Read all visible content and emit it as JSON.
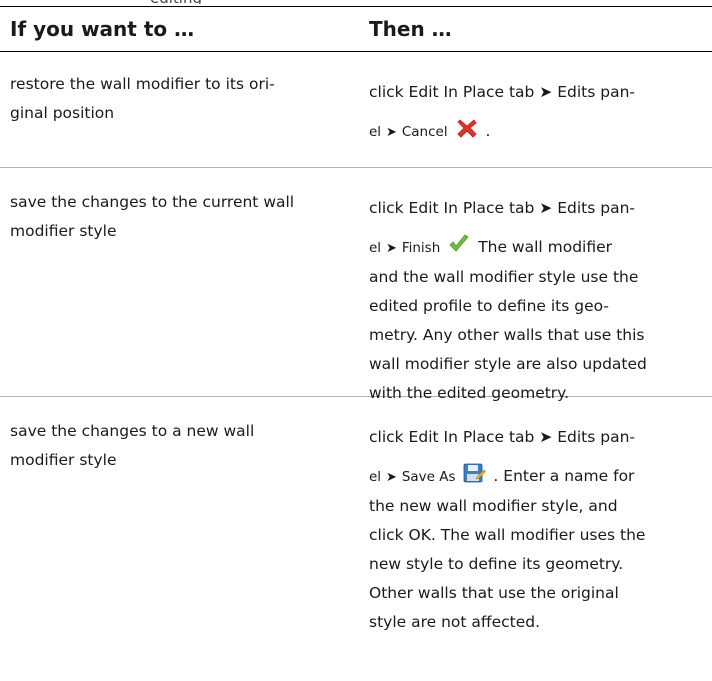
{
  "top_cut_text": "editing",
  "table": {
    "header": {
      "col1": "If you want to …",
      "col2": "Then …"
    },
    "rows": [
      {
        "col1_lines": [
          "restore the wall modifier to its ori-",
          "ginal position"
        ],
        "col2_line1": "click Edit In Place tab ➤ Edits pan-",
        "col2_prefix": "el",
        "col2_arrow": "➤",
        "col2_action": "Cancel",
        "col2_icon": "cancel-x-icon",
        "col2_after": ".",
        "col2_rest": []
      },
      {
        "col1_lines": [
          "save the changes to the current wall",
          "modifier style"
        ],
        "col2_line1": "click Edit In Place tab ➤ Edits pan-",
        "col2_prefix": "el",
        "col2_arrow": "➤",
        "col2_action": "Finish",
        "col2_icon": "checkmark-icon",
        "col2_after": "The wall modifier",
        "col2_rest": [
          "and the wall modifier style use the",
          "edited profile to define its geo-",
          "metry. Any other walls that use this",
          "wall modifier style are also updated",
          "with the edited geometry."
        ]
      },
      {
        "col1_lines": [
          "save the changes to a new wall",
          "modifier style"
        ],
        "col2_line1": "click Edit In Place tab ➤ Edits pan-",
        "col2_prefix": "el",
        "col2_arrow": "➤",
        "col2_action": "Save As",
        "col2_icon": "save-as-icon",
        "col2_after": ". Enter a name for",
        "col2_rest": [
          "the new wall modifier style, and",
          "click OK. The wall modifier uses the",
          "new style to define its geometry.",
          "Other walls that use the original",
          "style are not affected."
        ]
      }
    ]
  },
  "colors": {
    "cancel": "#e0332b",
    "finish": "#6cbf3d",
    "saveas": "#3d7fc1"
  }
}
